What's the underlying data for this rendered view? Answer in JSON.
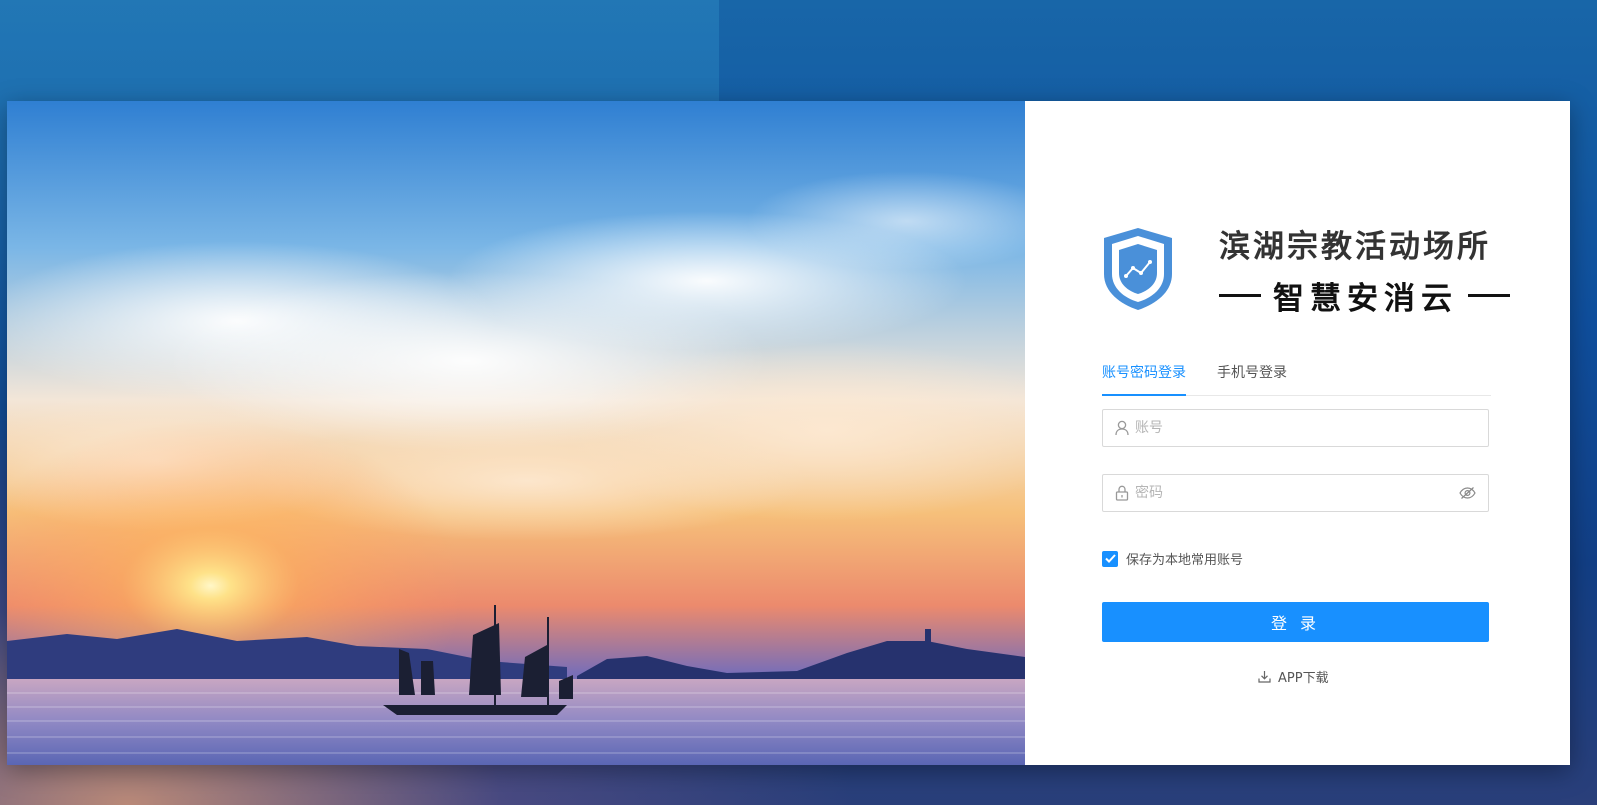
{
  "brand": {
    "title": "滨湖宗教活动场所",
    "subtitle": "智慧安消云",
    "colors": {
      "shield": "#4a90d9",
      "primary": "#1890ff"
    }
  },
  "tabs": [
    {
      "label": "账号密码登录",
      "active": true
    },
    {
      "label": "手机号登录",
      "active": false
    }
  ],
  "form": {
    "username": {
      "placeholder": "账号",
      "value": "",
      "icon": "user-icon"
    },
    "password": {
      "placeholder": "密码",
      "value": "",
      "icon": "lock-icon",
      "suffix_icon": "eye-off-icon"
    },
    "remember": {
      "label": "保存为本地常用账号",
      "checked": true
    },
    "submit_label": "登 录"
  },
  "footer": {
    "app_download_label": "APP下载",
    "icon": "download-icon"
  }
}
